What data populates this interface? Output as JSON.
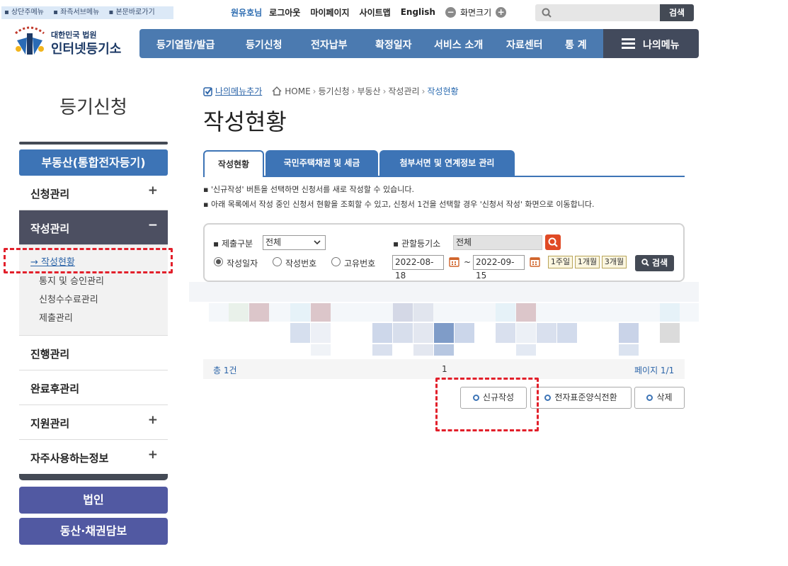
{
  "skip_links": [
    "상단주메뉴",
    "좌측서브메뉴",
    "본문바로가기"
  ],
  "util": {
    "user": "원유호님",
    "logout": "로그아웃",
    "mypage": "마이페이지",
    "sitemap": "사이트맵",
    "english": "English",
    "zoom_label": "화면크기",
    "search_button": "검색"
  },
  "logo": {
    "small": "대한민국 법원",
    "big": "인터넷등기소"
  },
  "gnb": [
    "등기열람/발급",
    "등기신청",
    "전자납부",
    "확정일자",
    "서비스 소개",
    "자료센터",
    "통 계"
  ],
  "my_menu": "나의메뉴",
  "sidebar": {
    "title": "등기신청",
    "main": "부동산(통합전자등기)",
    "items": [
      {
        "label": "신청관리",
        "mark": "+"
      },
      {
        "label": "작성관리",
        "mark": "−"
      },
      {
        "label": "진행관리",
        "mark": ""
      },
      {
        "label": "완료후관리",
        "mark": ""
      },
      {
        "label": "지원관리",
        "mark": "+"
      },
      {
        "label": "자주사용하는정보",
        "mark": "+"
      }
    ],
    "sub_items": [
      "→ 작성현황",
      "통지 및 승인관리",
      "신청수수료관리",
      "제출관리"
    ],
    "buttons": [
      "법인",
      "동산·채권담보"
    ]
  },
  "breadcrumb": {
    "add": "나의메뉴추가",
    "items": [
      "HOME",
      "등기신청",
      "부동산",
      "작성관리",
      "작성현황"
    ]
  },
  "page_title": "작성현황",
  "tabs": [
    "작성현황",
    "국민주택채권 및 세금",
    "첨부서면 및 연계정보 관리"
  ],
  "notes": [
    "'신규작성' 버튼을 선택하면 신청서를 새로 작성할 수 있습니다.",
    "아래 목록에서 작성 중인 신청서 현황을 조회할 수 있고, 신청서 1건을 선택할 경우 '신청서 작성' 화면으로 이동합니다."
  ],
  "filter": {
    "submit_label": "제출구분",
    "submit_value": "전체",
    "registry_label": "관할등기소",
    "registry_value": "전체",
    "radios": [
      {
        "label": "작성일자",
        "checked": true
      },
      {
        "label": "작성번호",
        "checked": false
      },
      {
        "label": "고유번호",
        "checked": false
      }
    ],
    "date_from": "2022-08-18",
    "date_sep": "~",
    "date_to": "2022-09-15",
    "quick": [
      "1주일",
      "1개월",
      "3개월"
    ],
    "search": "검색"
  },
  "pager": {
    "total": "총 1건",
    "page": "1",
    "info": "페이지 1/1"
  },
  "actions": [
    "신규작성",
    "전자표준양식전환",
    "삭제"
  ],
  "colors": {
    "nav": "#4b7ab0",
    "sidebar_main": "#3d74b6",
    "active": "#4c4f61",
    "highlight": "#e2202b",
    "side_button": "#5159a2"
  }
}
